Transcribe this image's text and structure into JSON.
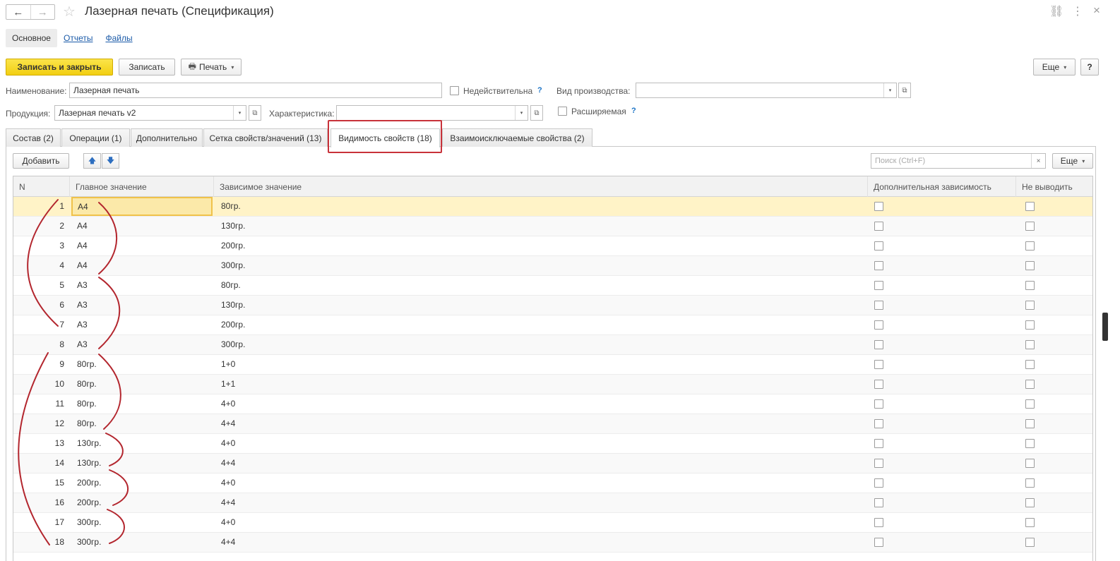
{
  "window": {
    "title": "Лазерная печать (Спецификация)",
    "back_icon": "←",
    "forward_icon": "→",
    "star_icon": "☆",
    "link_icon": "⛓",
    "menu_icon": "⋮",
    "close_icon": "×"
  },
  "section_tabs": [
    {
      "label": "Основное",
      "active": true
    },
    {
      "label": "Отчеты",
      "active": false
    },
    {
      "label": "Файлы",
      "active": false
    }
  ],
  "toolbar": {
    "save_close_label": "Записать и закрыть",
    "save_label": "Записать",
    "print_label": "Печать",
    "print_icon": "🖶",
    "more_label": "Еще",
    "help_label": "?",
    "dropdown_caret": "▾"
  },
  "form": {
    "name_label": "Наименование:",
    "name_value": "Лазерная печать",
    "invalid_label": "Недействительна",
    "production_type_label": "Вид производства:",
    "production_type_value": "",
    "product_label": "Продукция:",
    "product_value": "Лазерная печать v2",
    "characteristic_label": "Характеристика:",
    "characteristic_value": "",
    "extendable_label": "Расширяемая",
    "help_mark": "?",
    "open_icon": "⧉",
    "dropdown_icon": "▾"
  },
  "tabs": [
    {
      "label": "Состав (2)",
      "active": false
    },
    {
      "label": "Операции (1)",
      "active": false
    },
    {
      "label": "Дополнительно",
      "active": false
    },
    {
      "label": "Сетка свойств/значений (13)",
      "active": false
    },
    {
      "label": "Видимость свойств (18)",
      "active": true
    },
    {
      "label": "Взаимоисключаемые свойства (2)",
      "active": false
    }
  ],
  "table_toolbar": {
    "add_label": "Добавить",
    "up_icon": "🡅",
    "down_icon": "🡇",
    "search_placeholder": "Поиск (Ctrl+F)",
    "clear_icon": "×",
    "more_label": "Еще",
    "dropdown_caret": "▾"
  },
  "table": {
    "columns": [
      "N",
      "Главное значение",
      "Зависимое значение",
      "Дополнительная зависимость",
      "Не выводить"
    ],
    "rows": [
      {
        "n": "1",
        "main": "А4",
        "dependent": "80гр.",
        "extra": false,
        "hide": false
      },
      {
        "n": "2",
        "main": "А4",
        "dependent": "130гр.",
        "extra": false,
        "hide": false
      },
      {
        "n": "3",
        "main": "А4",
        "dependent": "200гр.",
        "extra": false,
        "hide": false
      },
      {
        "n": "4",
        "main": "А4",
        "dependent": "300гр.",
        "extra": false,
        "hide": false
      },
      {
        "n": "5",
        "main": "А3",
        "dependent": "80гр.",
        "extra": false,
        "hide": false
      },
      {
        "n": "6",
        "main": "А3",
        "dependent": "130гр.",
        "extra": false,
        "hide": false
      },
      {
        "n": "7",
        "main": "А3",
        "dependent": "200гр.",
        "extra": false,
        "hide": false
      },
      {
        "n": "8",
        "main": "А3",
        "dependent": "300гр.",
        "extra": false,
        "hide": false
      },
      {
        "n": "9",
        "main": "80гр.",
        "dependent": "1+0",
        "extra": false,
        "hide": false
      },
      {
        "n": "10",
        "main": "80гр.",
        "dependent": "1+1",
        "extra": false,
        "hide": false
      },
      {
        "n": "11",
        "main": "80гр.",
        "dependent": "4+0",
        "extra": false,
        "hide": false
      },
      {
        "n": "12",
        "main": "80гр.",
        "dependent": "4+4",
        "extra": false,
        "hide": false
      },
      {
        "n": "13",
        "main": "130гр.",
        "dependent": "4+0",
        "extra": false,
        "hide": false
      },
      {
        "n": "14",
        "main": "130гр.",
        "dependent": "4+4",
        "extra": false,
        "hide": false
      },
      {
        "n": "15",
        "main": "200гр.",
        "dependent": "4+0",
        "extra": false,
        "hide": false
      },
      {
        "n": "16",
        "main": "200гр.",
        "dependent": "4+4",
        "extra": false,
        "hide": false
      },
      {
        "n": "17",
        "main": "300гр.",
        "dependent": "4+0",
        "extra": false,
        "hide": false
      },
      {
        "n": "18",
        "main": "300гр.",
        "dependent": "4+4",
        "extra": false,
        "hide": false
      }
    ]
  },
  "colors": {
    "accent_yellow": "#f5d21f",
    "annotation_red": "#b3262e",
    "selected_row": "#fff3c7",
    "link_blue": "#1a5aa8"
  }
}
